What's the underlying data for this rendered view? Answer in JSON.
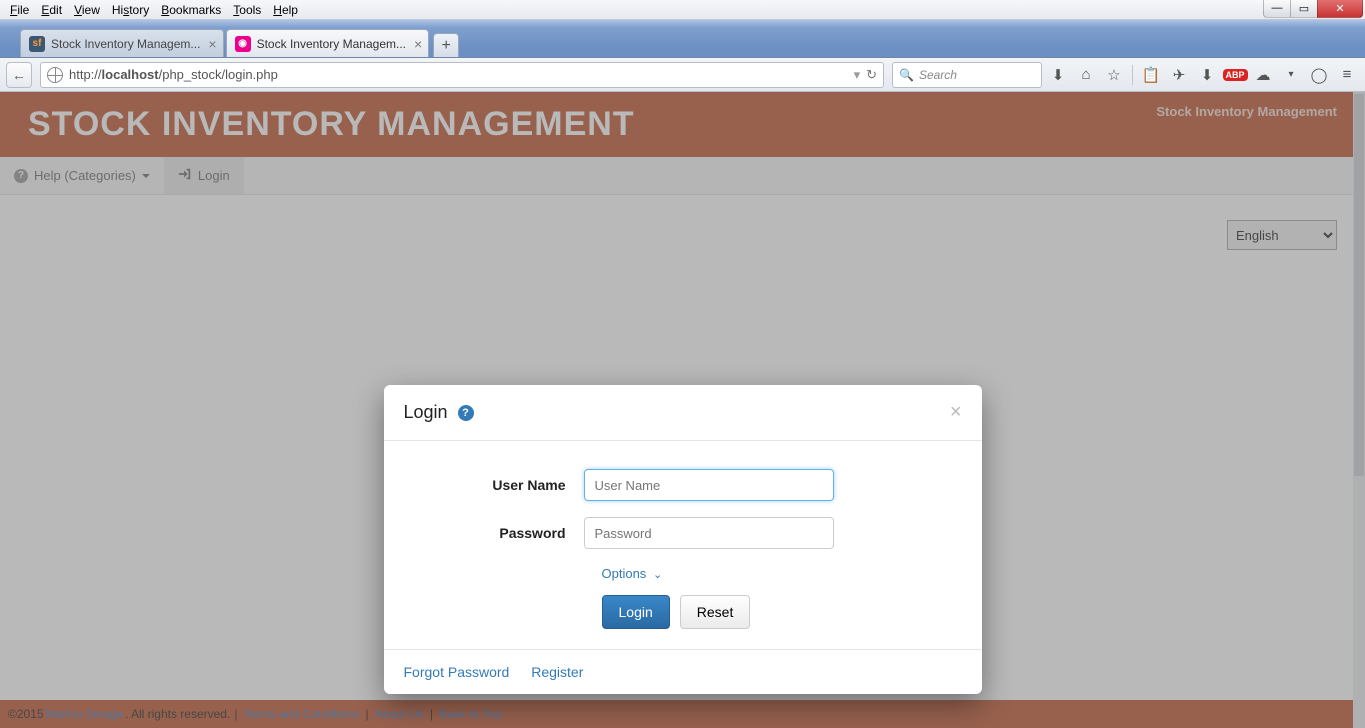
{
  "os_menu": [
    "File",
    "Edit",
    "View",
    "History",
    "Bookmarks",
    "Tools",
    "Help"
  ],
  "tabs": [
    {
      "label": "Stock Inventory Managem...",
      "favicon": "sf"
    },
    {
      "label": "Stock Inventory Managem...",
      "favicon": "pm"
    }
  ],
  "active_tab": 1,
  "url": {
    "prefix": "http://",
    "host": "localhost",
    "path": "/php_stock/login.php"
  },
  "search_placeholder": "Search",
  "page": {
    "brand": "STOCK INVENTORY MANAGEMENT",
    "subbrand": "Stock Inventory Management",
    "nav": {
      "help_label": "Help (Categories)",
      "login_label": "Login"
    },
    "language_selected": "English"
  },
  "modal": {
    "title": "Login",
    "username_label": "User Name",
    "username_placeholder": "User Name",
    "password_label": "Password",
    "password_placeholder": "Password",
    "options_label": "Options",
    "login_btn": "Login",
    "reset_btn": "Reset",
    "forgot_label": "Forgot Password",
    "register_label": "Register"
  },
  "footer": {
    "copyright_prefix": "©2015 ",
    "author": "Marinu Sinaga",
    "rights": ". All rights reserved. ",
    "terms": "Terms and Conditions",
    "about": "About Us",
    "back": "Back to Top"
  }
}
